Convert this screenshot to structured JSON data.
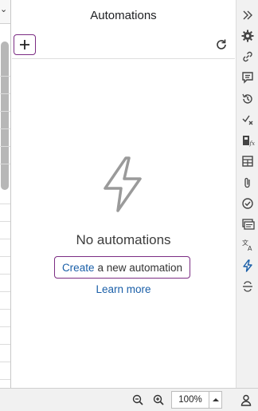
{
  "panel": {
    "title": "Automations",
    "empty_state": {
      "heading": "No automations",
      "create_link": "Create",
      "create_rest": "a new automation",
      "learn_more": "Learn more"
    }
  },
  "status_bar": {
    "zoom": "100%"
  },
  "colors": {
    "accent_border": "#7b2c83",
    "link": "#1a5fa8"
  },
  "icons": {
    "right_sidebar": [
      "collapse-icon",
      "settings-gear-icon",
      "link-icon",
      "comment-icon",
      "history-icon",
      "spellcheck-icon",
      "formula-icon",
      "table-icon",
      "attachment-icon",
      "checkmark-circle-icon",
      "cards-icon",
      "translate-icon",
      "automation-bolt-icon",
      "more-icon"
    ]
  }
}
